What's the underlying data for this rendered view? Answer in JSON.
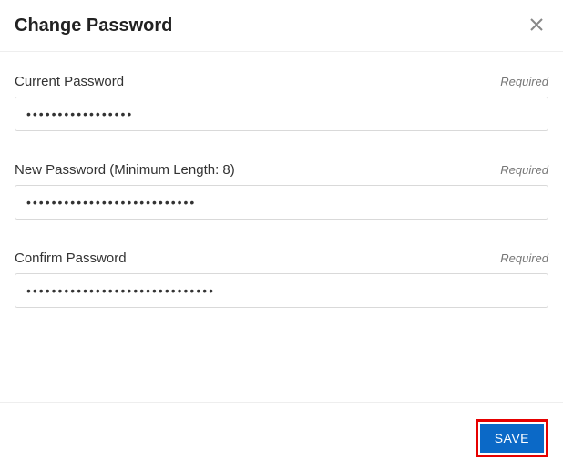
{
  "header": {
    "title": "Change Password"
  },
  "fields": {
    "current": {
      "label": "Current Password",
      "required_text": "Required",
      "value": "•••••••••••••••••"
    },
    "new": {
      "label": "New Password (Minimum Length: 8)",
      "required_text": "Required",
      "value": "•••••••••••••••••••••••••••"
    },
    "confirm": {
      "label": "Confirm Password",
      "required_text": "Required",
      "value": "••••••••••••••••••••••••••••••"
    }
  },
  "footer": {
    "save_label": "SAVE"
  }
}
